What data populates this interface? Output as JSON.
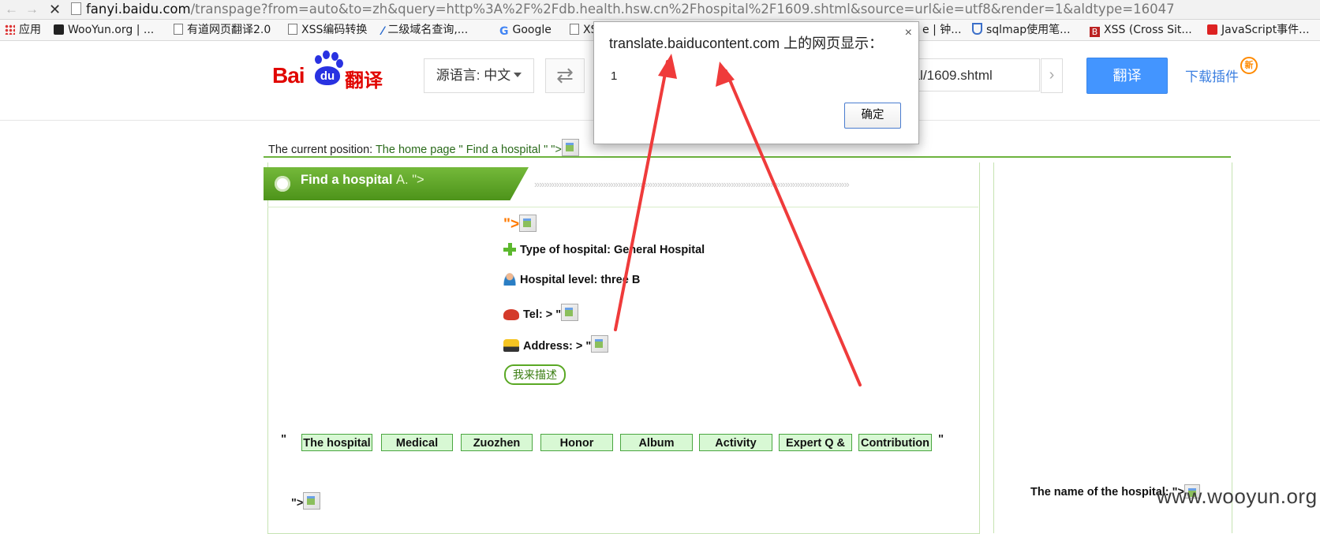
{
  "browser": {
    "back_glyph": "←",
    "forward_glyph": "→",
    "stop_glyph": "✕",
    "url_domain": "fanyi.baidu.com",
    "url_path": "/transpage?from=auto&to=zh&query=http%3A%2F%2Fdb.health.hsw.cn%2Fhospital%2F1609.shtml&source=url&ie=utf8&render=1&aldtype=16047"
  },
  "bookmarks": [
    {
      "icon": "apps-icon",
      "label": "应用"
    },
    {
      "icon": "wooyun-icon",
      "label": "WooYun.org | ..."
    },
    {
      "icon": "page-icon",
      "label": "有道网页翻译2.0"
    },
    {
      "icon": "page-icon",
      "label": "XSS编码转换"
    },
    {
      "icon": "link-icon",
      "label": "二级域名查询,..."
    },
    {
      "icon": "google-icon",
      "label": "Google"
    },
    {
      "icon": "page-icon",
      "label": "XS"
    },
    {
      "icon": "page-icon",
      "label": "e | 钟..."
    },
    {
      "icon": "shield-icon",
      "label": "sqlmap使用笔..."
    },
    {
      "icon": "xss-icon",
      "label": "XSS (Cross Sit..."
    },
    {
      "icon": "js-icon",
      "label": "JavaScript事件..."
    }
  ],
  "header": {
    "logo_text": "Bai",
    "logo_paw_text": "du",
    "logo_product": "翻译",
    "source_lang": "源语言: 中文",
    "swap_glyph": "⇄",
    "url_input_value": "tal/1609.shtml",
    "go_glyph": "›",
    "translate_label": "翻译",
    "download_label": "下载插件",
    "new_badge": "新"
  },
  "page": {
    "breadcrumb_prefix": "The current position: ",
    "breadcrumb_link": "The home page \" Find a hospital \" \">",
    "title_main": "Find a hospital ",
    "title_tail": "A. \">",
    "chevrons": "»»»»»»»»»»»»»»»»»»»»»»»»»»»»»»»»»»»»»»»»»»»»»»»»»»»»»»»»»»»»»»»»",
    "quote_orange": "\">",
    "hospital_type": "Type of hospital: General Hospital",
    "hospital_level": "Hospital level: three B",
    "tel": "Tel: > \"",
    "address": "Address: > \"",
    "describe_button": "我来描述",
    "tab_quote_open": "\"",
    "tab_quote_close": "\"",
    "tabs": [
      "The hospital",
      "Medical",
      "Zuozhen",
      "Honor",
      "Album",
      "Activity",
      "Expert Q &",
      "Contribution"
    ],
    "bottom_quote": "\">",
    "hospital_name_label": "The name of the hospital: \">",
    "watermark": "www.wooyun.org"
  },
  "dialog": {
    "title": "translate.baiducontent.com 上的网页显示：",
    "close_glyph": "×",
    "message": "1",
    "ok_label": "确定"
  },
  "annotation_color": "#ef3b3b"
}
